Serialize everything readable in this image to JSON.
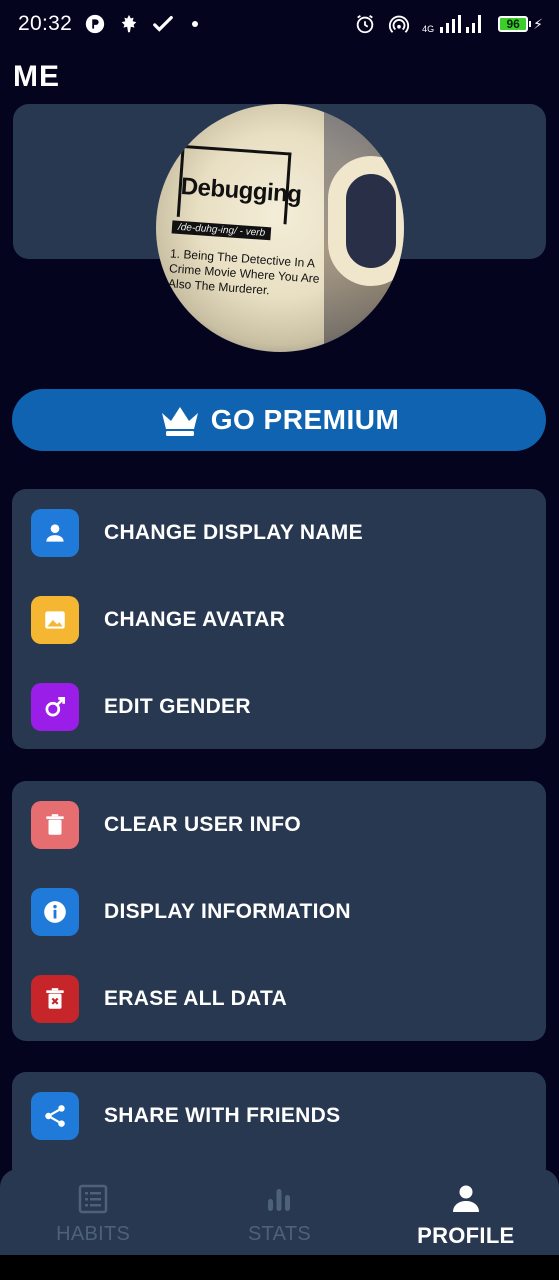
{
  "status_bar": {
    "time": "20:32",
    "network_label": "4G",
    "battery_level": "96",
    "icons": [
      "app-p-icon",
      "maple-leaf-icon",
      "check-icon",
      "dot-icon",
      "alarm-icon",
      "hotspot-icon",
      "signal-icon",
      "battery-icon",
      "charging-icon"
    ]
  },
  "header": {
    "title": "ME"
  },
  "avatar": {
    "alt_description": "avatar-photo",
    "mug_word": "Debugging",
    "mug_phonetic": "/de-duhg-ing/ - verb",
    "mug_definition": "1. Being The Detective In A Crime Movie Where You Are Also The Murderer."
  },
  "premium_button": {
    "label": "GO PREMIUM",
    "icon": "crown-icon",
    "color": "#0f63b0"
  },
  "profile_section": {
    "items": [
      {
        "label": "CHANGE DISPLAY NAME",
        "icon": "person-icon",
        "color": "#1f7ad9"
      },
      {
        "label": "CHANGE AVATAR",
        "icon": "image-icon",
        "color": "#f5b731"
      },
      {
        "label": "EDIT GENDER",
        "icon": "male-icon",
        "color": "#9a1de8"
      }
    ]
  },
  "data_section": {
    "items": [
      {
        "label": "CLEAR USER INFO",
        "icon": "trash-icon",
        "color": "#e66e70"
      },
      {
        "label": "DISPLAY INFORMATION",
        "icon": "info-icon",
        "color": "#1f7ad9"
      },
      {
        "label": "ERASE ALL DATA",
        "icon": "delete-forever-icon",
        "color": "#c6262a"
      }
    ]
  },
  "share_section": {
    "items": [
      {
        "label": "SHARE WITH FRIENDS",
        "icon": "share-icon",
        "color": "#1f7ad9"
      }
    ]
  },
  "bottom_nav": {
    "tabs": [
      {
        "label": "HABITS",
        "icon": "list-icon",
        "active": false
      },
      {
        "label": "STATS",
        "icon": "bar-chart-icon",
        "active": false
      },
      {
        "label": "PROFILE",
        "icon": "person-icon",
        "active": true
      }
    ]
  },
  "theme": {
    "background": "#04041f",
    "card": "#283850",
    "inactive_nav": "#4d6179"
  }
}
